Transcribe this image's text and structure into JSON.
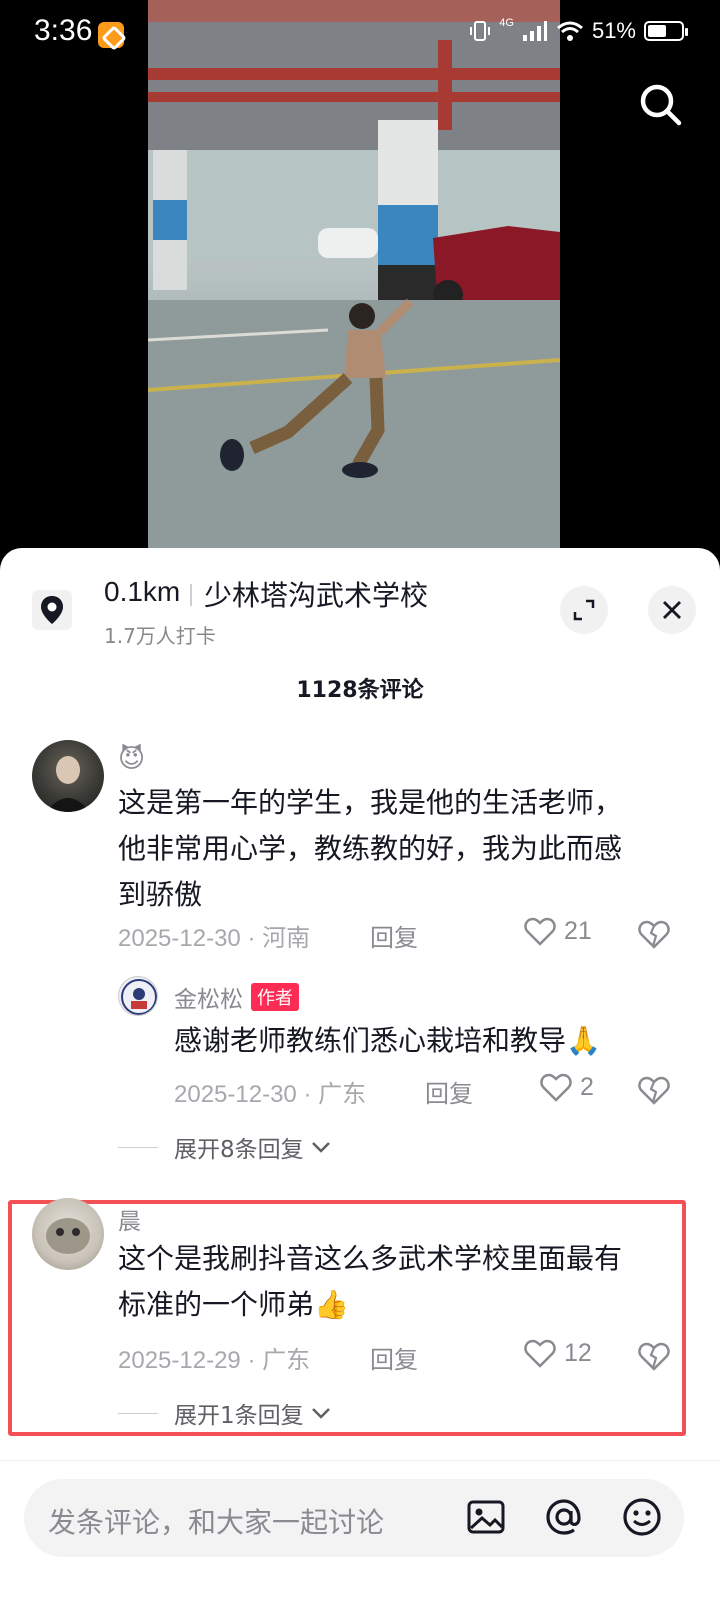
{
  "status_bar": {
    "time": "3:36",
    "network": "4G",
    "battery": "51%"
  },
  "location": {
    "distance": "0.1km",
    "name": "少林塔沟武术学校",
    "checkins": "1.7万人打卡"
  },
  "comments_header": {
    "count_label": "1128条评论"
  },
  "comments": [
    {
      "user": "😈",
      "text_lines": [
        "这是第一年的学生，我是他的生活老师，",
        "他非常用心学，教练教的好，我为此而感",
        "到骄傲"
      ],
      "date": "2025-12-30",
      "region": "河南",
      "reply_label": "回复",
      "likes": "21",
      "replies": [
        {
          "user": "金松松",
          "badge": "作者",
          "text": "感谢老师教练们悉心栽培和教导🙏",
          "date": "2025-12-30",
          "region": "广东",
          "reply_label": "回复",
          "likes": "2"
        }
      ],
      "expand_label": "展开8条回复"
    },
    {
      "user": "晨",
      "text_lines": [
        "这个是我刷抖音这么多武术学校里面最有",
        "标准的一个师弟👍"
      ],
      "date": "2025-12-29",
      "region": "广东",
      "reply_label": "回复",
      "likes": "12",
      "expand_label": "展开1条回复"
    }
  ],
  "input": {
    "placeholder": "发条评论，和大家一起讨论"
  },
  "icons": [
    "search-icon",
    "location-pin-icon",
    "expand-icon",
    "close-icon",
    "heart-icon",
    "broken-heart-icon",
    "chevron-down-icon",
    "image-icon",
    "at-icon",
    "emoji-icon"
  ],
  "colors": {
    "author_badge": "#fe2c55",
    "highlight": "#f25054",
    "text": "#161823",
    "muted": "#8a8b91"
  }
}
